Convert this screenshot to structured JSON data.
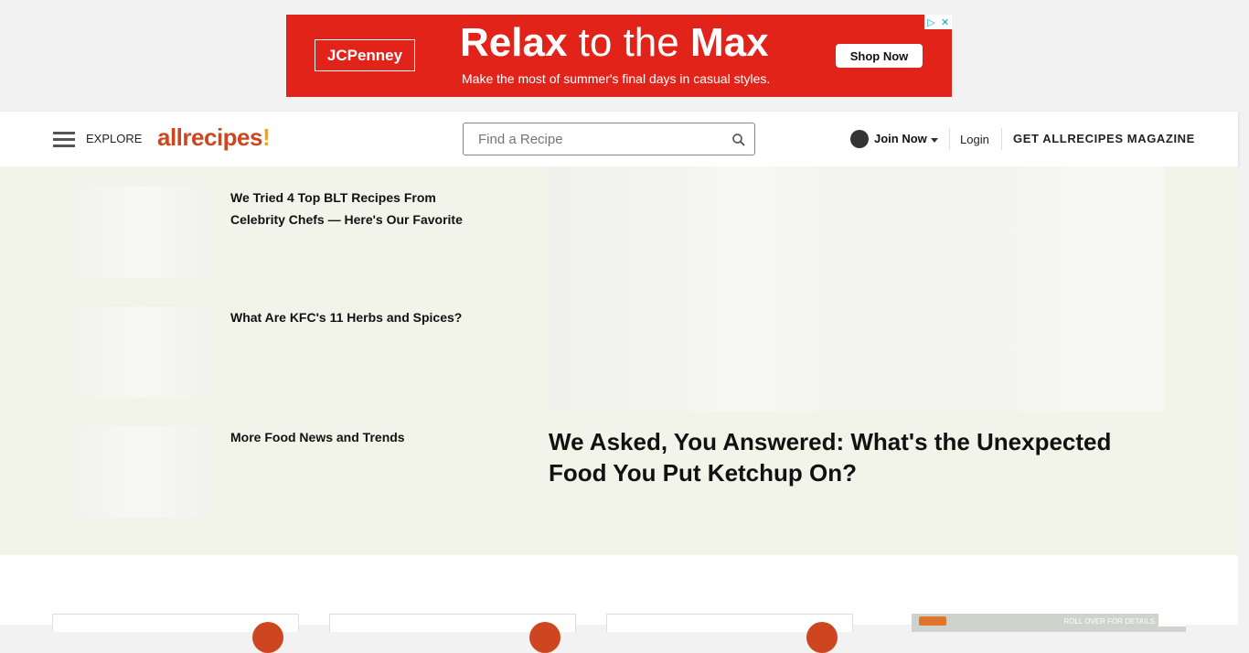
{
  "ad": {
    "brand": "JCPenney",
    "headline_bold1": "Relax",
    "headline_thin": " to the ",
    "headline_bold2": "Max",
    "subline": "Make the most of summer's final days in casual styles.",
    "cta": "Shop Now",
    "adchoices_icon": "adchoices-icon",
    "close_icon": "close-icon",
    "background_color": "#e2231a"
  },
  "header": {
    "explore_label": "EXPLORE",
    "logo_text": "allrecipes",
    "logo_mark": "!",
    "search_placeholder": "Find a Recipe",
    "join_label": "Join Now",
    "login_label": "Login",
    "magazine_label": "GET ALLRECIPES MAGAZINE",
    "brand_color": "#ce4620"
  },
  "news": {
    "items": [
      {
        "title": "We Tried 4 Top BLT Recipes From Celebrity Chefs — Here's Our Favorite"
      },
      {
        "title": "What Are KFC's 11 Herbs and Spices?"
      },
      {
        "title": "More Food News and Trends"
      }
    ],
    "feature_title": "We Asked, You Answered: What's the Unexpected Food You Put Ketchup On?",
    "background_color": "#f2f4ea"
  },
  "bottom_ad": {
    "text": "ROLL OVER FOR DETAILS"
  }
}
